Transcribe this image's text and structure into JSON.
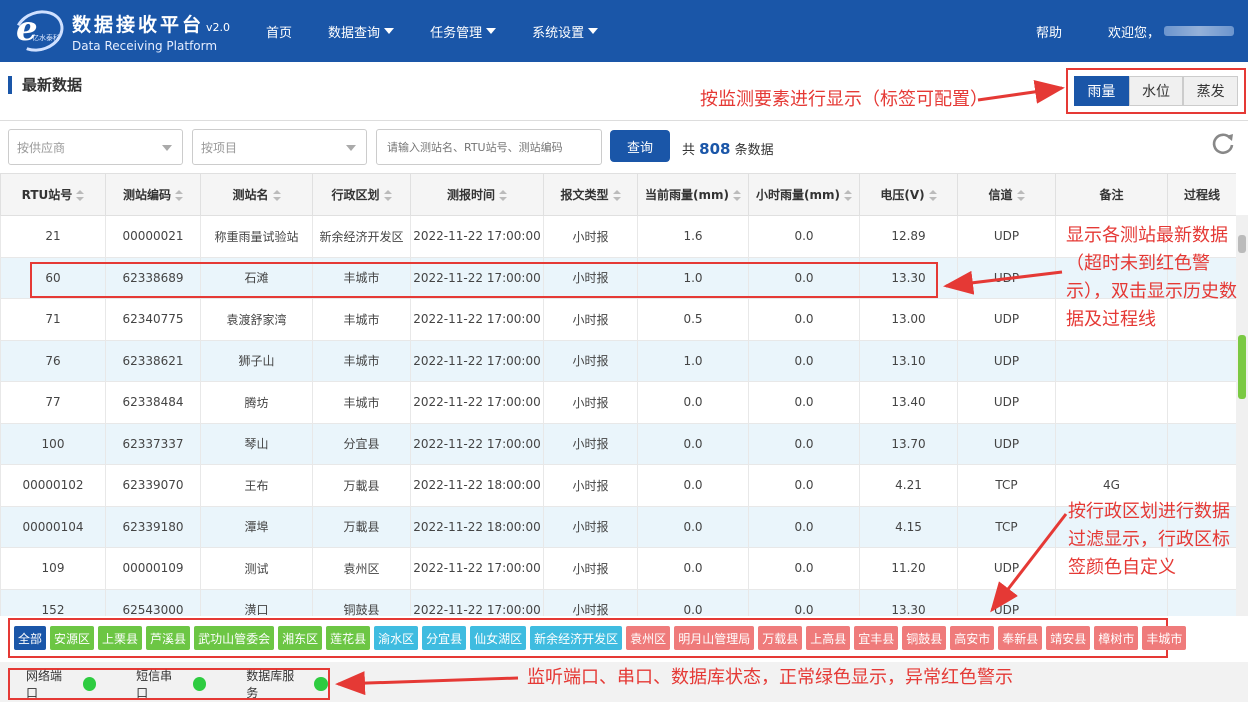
{
  "header": {
    "logo_glyph": "e",
    "logo_sub": "亿水泰科",
    "title_cn": "数据接收平台",
    "version": "v2.0",
    "title_en": "Data Receiving Platform",
    "nav": [
      {
        "label": "首页",
        "dropdown": false
      },
      {
        "label": "数据查询",
        "dropdown": true
      },
      {
        "label": "任务管理",
        "dropdown": true
      },
      {
        "label": "系统设置",
        "dropdown": true
      }
    ],
    "help": "帮助",
    "welcome": "欢迎您，"
  },
  "section": {
    "title": "最新数据",
    "tabs": [
      {
        "label": "雨量",
        "active": true
      },
      {
        "label": "水位",
        "active": false
      },
      {
        "label": "蒸发",
        "active": false
      }
    ]
  },
  "filter": {
    "supplier_placeholder": "按供应商",
    "project_placeholder": "按项目",
    "search_placeholder": "请输入测站名、RTU站号、测站编码",
    "query_label": "查询",
    "count_prefix": "共",
    "count_value": "808",
    "count_suffix": "条数据"
  },
  "table": {
    "columns": [
      {
        "label": "RTU站号",
        "sortable": true
      },
      {
        "label": "测站编码",
        "sortable": true
      },
      {
        "label": "测站名",
        "sortable": true
      },
      {
        "label": "行政区划",
        "sortable": true
      },
      {
        "label": "测报时间",
        "sortable": true
      },
      {
        "label": "报文类型",
        "sortable": true
      },
      {
        "label": "当前雨量(mm)",
        "sortable": true
      },
      {
        "label": "小时雨量(mm)",
        "sortable": true
      },
      {
        "label": "电压(V)",
        "sortable": true
      },
      {
        "label": "信道",
        "sortable": true
      },
      {
        "label": "备注",
        "sortable": false
      },
      {
        "label": "过程线",
        "sortable": false
      }
    ],
    "rows": [
      [
        "21",
        "00000021",
        "称重雨量试验站",
        "新余经济开发区",
        "2022-11-22 17:00:00",
        "小时报",
        "1.6",
        "0.0",
        "12.89",
        "UDP",
        "",
        ""
      ],
      [
        "60",
        "62338689",
        "石滩",
        "丰城市",
        "2022-11-22 17:00:00",
        "小时报",
        "1.0",
        "0.0",
        "13.30",
        "UDP",
        "",
        ""
      ],
      [
        "71",
        "62340775",
        "袁渡舒家湾",
        "丰城市",
        "2022-11-22 17:00:00",
        "小时报",
        "0.5",
        "0.0",
        "13.00",
        "UDP",
        "",
        ""
      ],
      [
        "76",
        "62338621",
        "狮子山",
        "丰城市",
        "2022-11-22 17:00:00",
        "小时报",
        "1.0",
        "0.0",
        "13.10",
        "UDP",
        "",
        ""
      ],
      [
        "77",
        "62338484",
        "腾坊",
        "丰城市",
        "2022-11-22 17:00:00",
        "小时报",
        "0.0",
        "0.0",
        "13.40",
        "UDP",
        "",
        ""
      ],
      [
        "100",
        "62337337",
        "琴山",
        "分宜县",
        "2022-11-22 17:00:00",
        "小时报",
        "0.0",
        "0.0",
        "13.70",
        "UDP",
        "",
        ""
      ],
      [
        "00000102",
        "62339070",
        "王布",
        "万載县",
        "2022-11-22 18:00:00",
        "小时报",
        "0.0",
        "0.0",
        "4.21",
        "TCP",
        "4G",
        ""
      ],
      [
        "00000104",
        "62339180",
        "潭埠",
        "万載县",
        "2022-11-22 18:00:00",
        "小时报",
        "0.0",
        "0.0",
        "4.15",
        "TCP",
        "",
        ""
      ],
      [
        "109",
        "00000109",
        "测试",
        "袁州区",
        "2022-11-22 17:00:00",
        "小时报",
        "0.0",
        "0.0",
        "11.20",
        "UDP",
        "",
        ""
      ],
      [
        "152",
        "62543000",
        "潢口",
        "铜鼓县",
        "2022-11-22 17:00:00",
        "小时报",
        "0.0",
        "0.0",
        "13.30",
        "UDP",
        "",
        ""
      ]
    ]
  },
  "regions": [
    {
      "label": "全部",
      "color": "#1a56a8"
    },
    {
      "label": "安源区",
      "color": "#6cc644"
    },
    {
      "label": "上栗县",
      "color": "#6cc644"
    },
    {
      "label": "芦溪县",
      "color": "#6cc644"
    },
    {
      "label": "武功山管委会",
      "color": "#6cc644"
    },
    {
      "label": "湘东区",
      "color": "#6cc644"
    },
    {
      "label": "莲花县",
      "color": "#6cc644"
    },
    {
      "label": "渝水区",
      "color": "#3fbce0"
    },
    {
      "label": "分宜县",
      "color": "#3fbce0"
    },
    {
      "label": "仙女湖区",
      "color": "#3fbce0"
    },
    {
      "label": "新余经济开发区",
      "color": "#3fbce0"
    },
    {
      "label": "袁州区",
      "color": "#ef7b7b"
    },
    {
      "label": "明月山管理局",
      "color": "#ef7b7b"
    },
    {
      "label": "万载县",
      "color": "#ef7b7b"
    },
    {
      "label": "上高县",
      "color": "#ef7b7b"
    },
    {
      "label": "宜丰县",
      "color": "#ef7b7b"
    },
    {
      "label": "铜鼓县",
      "color": "#ef7b7b"
    },
    {
      "label": "高安市",
      "color": "#ef7b7b"
    },
    {
      "label": "奉新县",
      "color": "#ef7b7b"
    },
    {
      "label": "靖安县",
      "color": "#ef7b7b"
    },
    {
      "label": "樟树市",
      "color": "#ef7b7b"
    },
    {
      "label": "丰城市",
      "color": "#ef7b7b"
    }
  ],
  "status": [
    {
      "label": "网络端口",
      "color": "#2ecc40"
    },
    {
      "label": "短信串口",
      "color": "#2ecc40"
    },
    {
      "label": "数据库服务",
      "color": "#2ecc40"
    }
  ],
  "annotations": {
    "tabs": "按监测要素进行显示（标签可配置）",
    "latest": [
      "显示各测站最新数据",
      "（超时未到红色警",
      "示），双击显示历史数",
      "据及过程线"
    ],
    "region": [
      "按行政区划进行数据",
      "过滤显示，行政区标",
      "签颜色自定义"
    ],
    "status": "监听端口、串口、数据库状态，正常绿色显示，异常红色警示"
  },
  "colors": {
    "header_bg": "#1a56a8",
    "alt_row": "#eaf5fb",
    "annotation": "#e53935",
    "status_ok": "#2ecc40"
  }
}
